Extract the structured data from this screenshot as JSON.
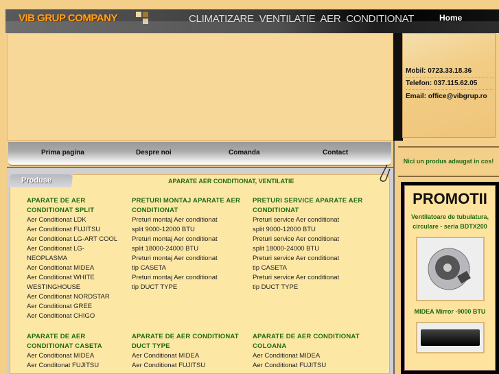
{
  "header": {
    "logo": "VIB GRUP COMPANY",
    "tagline": "CLIMATIZARE  VENTILATIE  AER CONDITIONAT",
    "home": "Home"
  },
  "contact": {
    "mobil": "Mobil:  0723.33.18.36",
    "telefon": "Telefon:  037.115.62.05",
    "email": "Email: office@vibgrup.ro"
  },
  "nav": [
    "Prima pagina",
    "Despre noi",
    "Comanda",
    "Contact"
  ],
  "cart": "Nici un produs adaugat in cos!",
  "promo": {
    "title": "PROMOTII",
    "item1": "Ventilatoare de tubulatura, circulare - seria BDTX200",
    "item2": "MIDEA Mirror -9000 BTU"
  },
  "products": {
    "tab": "Produse",
    "title": "APARATE AER CONDITIONAT, VENTILATIE",
    "sections": [
      {
        "heading": "APARATE DE AER CONDITIONAT SPLIT",
        "items": [
          "Aer Conditionat LDK",
          "Aer Conditionat FUJITSU",
          "Aer Conditionat LG-ART COOL",
          "Aer Conditionat LG-NEOPLASMA",
          "Aer Conditionat MIDEA",
          "Aer Conditionat WHITE WESTINGHOUSE",
          "Aer Conditionat NORDSTAR",
          "Aer Conditionat GREE",
          "Aer Conditionat CHIGO"
        ]
      },
      {
        "heading": "PRETURI MONTAJ APARATE AER CONDITIONAT",
        "items": [
          "Preturi montaj Aer conditionat split 9000-12000 BTU",
          "Preturi montaj Aer conditionat split 18000-24000 BTU",
          "Preturi montaj Aer conditionat tip CASETA",
          "Preturi montaj Aer conditionat tip DUCT TYPE"
        ]
      },
      {
        "heading": "PRETURI SERVICE APARATE AER CONDITIONAT",
        "items": [
          "Preturi service Aer conditionat split 9000-12000 BTU",
          "Preturi service Aer conditionat split 18000-24000 BTU",
          "Preturi service Aer conditionat tip CASETA",
          "Preturi service Aer conditionat tip DUCT TYPE"
        ]
      },
      {
        "heading": "APARATE DE AER CONDITIONAT CASETA",
        "items": [
          "Aer Conditionat MIDEA",
          "Aer Conditonat FUJITSU"
        ]
      },
      {
        "heading": "APARATE DE AER CONDITIONAT DUCT TYPE",
        "items": [
          "Aer Conditionat MIDEA",
          "Aer Conditionat FUJITSU"
        ]
      },
      {
        "heading": "APARATE DE AER CONDITIONAT COLOANA",
        "items": [
          "Aer Conditionat MIDEA",
          "Aer Conditionat FUJITSU"
        ]
      }
    ]
  }
}
